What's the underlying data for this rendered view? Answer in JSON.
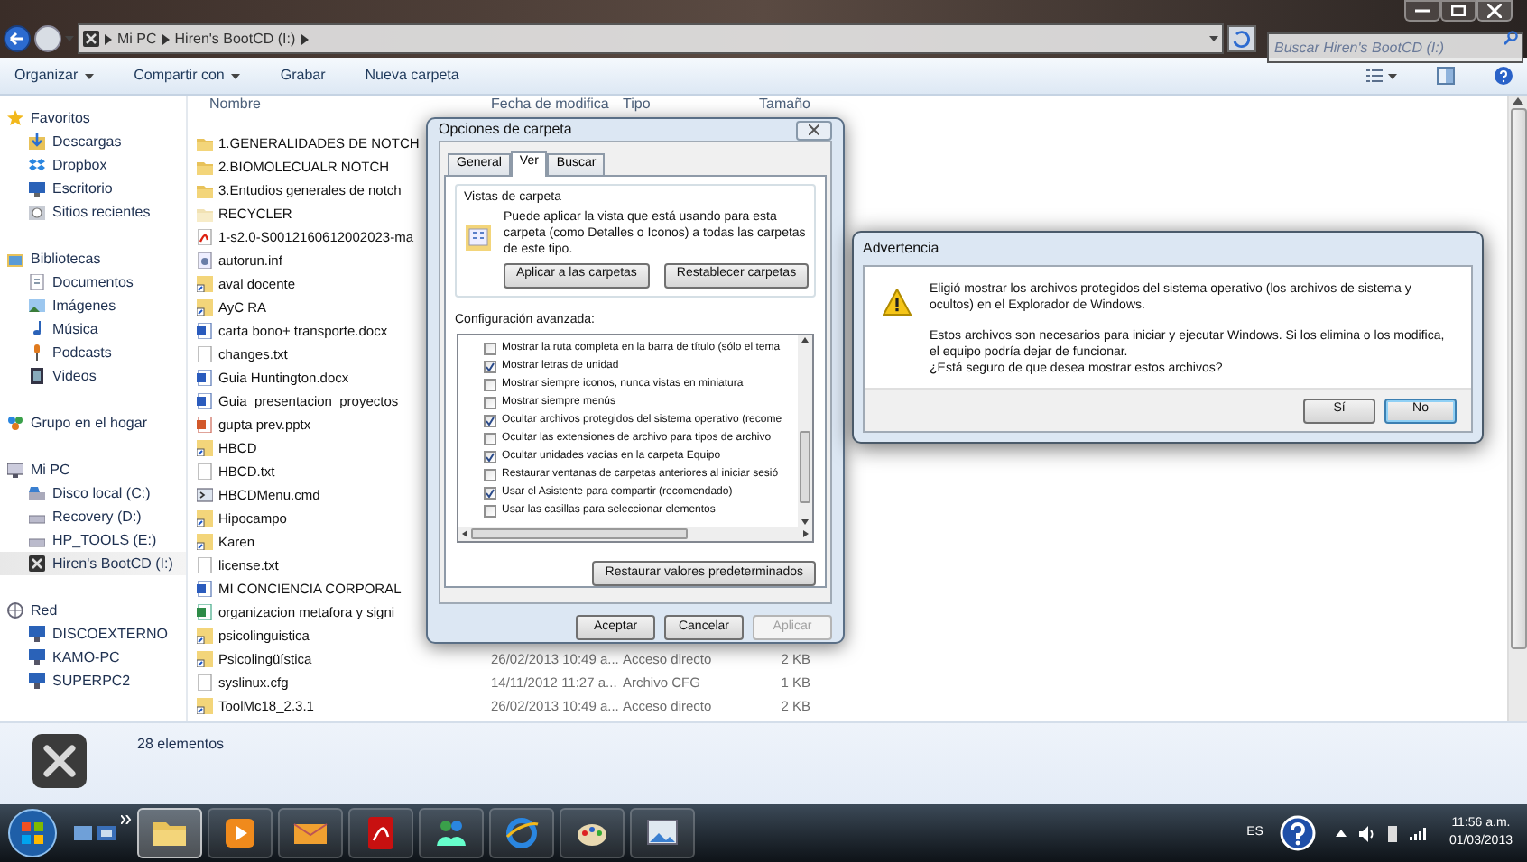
{
  "window": {
    "breadcrumbs": [
      "Mi PC",
      "Hiren's BootCD (I:)"
    ],
    "search": {
      "placeholder": "Buscar Hiren's BootCD (I:)"
    }
  },
  "toolbar": [
    {
      "label": "Organizar",
      "menu": true
    },
    {
      "label": "Compartir con",
      "menu": true
    },
    {
      "label": "Grabar",
      "menu": false
    },
    {
      "label": "Nueva carpeta",
      "menu": false
    }
  ],
  "sidebar": [
    {
      "label": "Favoritos",
      "kind": "star",
      "selected": false,
      "children": [
        {
          "label": "Descargas",
          "kind": "download",
          "selected": false
        },
        {
          "label": "Dropbox",
          "kind": "dropbox",
          "selected": false
        },
        {
          "label": "Escritorio",
          "kind": "desktop",
          "selected": false
        },
        {
          "label": "Sitios recientes",
          "kind": "recent",
          "selected": false
        }
      ]
    },
    {
      "label": "Bibliotecas",
      "kind": "library",
      "selected": false,
      "children": [
        {
          "label": "Documentos",
          "kind": "documents",
          "selected": false
        },
        {
          "label": "Imágenes",
          "kind": "images",
          "selected": false
        },
        {
          "label": "Música",
          "kind": "music",
          "selected": false
        },
        {
          "label": "Podcasts",
          "kind": "podcast",
          "selected": false
        },
        {
          "label": "Videos",
          "kind": "video",
          "selected": false
        }
      ]
    },
    {
      "label": "Grupo en el hogar",
      "kind": "homegroup",
      "selected": false
    },
    {
      "label": "Mi PC",
      "kind": "computer",
      "selected": false,
      "children": [
        {
          "label": "Disco local (C:)",
          "kind": "drive",
          "selected": false
        },
        {
          "label": "Recovery (D:)",
          "kind": "removable",
          "selected": false
        },
        {
          "label": "HP_TOOLS (E:)",
          "kind": "removable",
          "selected": false
        },
        {
          "label": "Hiren's BootCD (I:)",
          "kind": "tools",
          "selected": true
        }
      ]
    },
    {
      "label": "Red",
      "kind": "network",
      "selected": false,
      "children": [
        {
          "label": "DISCOEXTERNO",
          "kind": "pc",
          "selected": false
        },
        {
          "label": "KAMO-PC",
          "kind": "pc",
          "selected": false
        },
        {
          "label": "SUPERPC2",
          "kind": "pc",
          "selected": false
        }
      ]
    }
  ],
  "table": {
    "columns": [
      "Nombre",
      "Fecha de modifica",
      "Tipo",
      "Tamaño"
    ],
    "rows": [
      {
        "kind": "folder",
        "name": "1.GENERALIDADES DE NOTCH"
      },
      {
        "kind": "folder",
        "name": "2.BIOMOLECUALR NOTCH"
      },
      {
        "kind": "folder",
        "name": "3.Entudios generales de notch"
      },
      {
        "kind": "hidden_folder",
        "name": "RECYCLER"
      },
      {
        "kind": "pdf",
        "name": "1-s2.0-S0012160612002023-ma"
      },
      {
        "kind": "config",
        "name": "autorun.inf"
      },
      {
        "kind": "shortcut",
        "name": "aval docente"
      },
      {
        "kind": "shortcut",
        "name": "AyC RA"
      },
      {
        "kind": "word",
        "name": "carta bono+ transporte.docx"
      },
      {
        "kind": "text",
        "name": "changes.txt"
      },
      {
        "kind": "word",
        "name": "Guia Huntington.docx"
      },
      {
        "kind": "word",
        "name": "Guia_presentacion_proyectos"
      },
      {
        "kind": "ppt",
        "name": "gupta prev.pptx"
      },
      {
        "kind": "shortcut",
        "name": "HBCD"
      },
      {
        "kind": "text",
        "name": "HBCD.txt"
      },
      {
        "kind": "cmd",
        "name": "HBCDMenu.cmd"
      },
      {
        "kind": "shortcut",
        "name": "Hipocampo"
      },
      {
        "kind": "shortcut",
        "name": "Karen"
      },
      {
        "kind": "text",
        "name": "license.txt"
      },
      {
        "kind": "word",
        "name": "MI CONCIENCIA CORPORAL"
      },
      {
        "kind": "excel",
        "name": "organizacion metafora y signi"
      },
      {
        "kind": "shortcut",
        "name": "psicolinguistica"
      },
      {
        "kind": "shortcut",
        "name": "Psicolingüística",
        "date": "26/02/2013 10:49 a...",
        "type": "Acceso directo",
        "size": "2 KB"
      },
      {
        "kind": "text",
        "name": "syslinux.cfg",
        "date": "14/11/2012 11:27 a...",
        "type": "Archivo CFG",
        "size": "1 KB"
      },
      {
        "kind": "shortcut",
        "name": "ToolMc18_2.3.1",
        "date": "26/02/2013 10:49 a...",
        "type": "Acceso directo",
        "size": "2 KB"
      }
    ]
  },
  "details": {
    "count": "28 elementos"
  },
  "folder_options": {
    "title": "Opciones de carpeta",
    "tabs": [
      {
        "label": "General",
        "selected": false
      },
      {
        "label": "Ver",
        "selected": true
      },
      {
        "label": "Buscar",
        "selected": false
      }
    ],
    "views_group": {
      "title": "Vistas de carpeta",
      "text": "Puede aplicar la vista que está usando para esta carpeta (como Detalles o Iconos) a todas las carpetas de este tipo.",
      "buttons": [
        "Aplicar a las carpetas",
        "Restablecer carpetas"
      ]
    },
    "advanced_label": "Configuración avanzada:",
    "settings": [
      {
        "label": "Mostrar la ruta completa en la barra de título (sólo el tema",
        "checked": false
      },
      {
        "label": "Mostrar letras de unidad",
        "checked": true
      },
      {
        "label": "Mostrar siempre iconos, nunca vistas en miniatura",
        "checked": false
      },
      {
        "label": "Mostrar siempre menús",
        "checked": false
      },
      {
        "label": "Ocultar archivos protegidos del sistema operativo (recome",
        "checked": true
      },
      {
        "label": "Ocultar las extensiones de archivo para tipos de archivo",
        "checked": false
      },
      {
        "label": "Ocultar unidades vacías en la carpeta Equipo",
        "checked": true
      },
      {
        "label": "Restaurar ventanas de carpetas anteriores al iniciar sesió",
        "checked": false
      },
      {
        "label": "Usar el Asistente para compartir (recomendado)",
        "checked": true
      },
      {
        "label": "Usar las casillas para seleccionar elementos",
        "checked": false
      }
    ],
    "restore_button": "Restaurar valores predeterminados",
    "buttons": [
      {
        "label": "Aceptar",
        "disabled": false
      },
      {
        "label": "Cancelar",
        "disabled": false
      },
      {
        "label": "Aplicar",
        "disabled": true
      }
    ]
  },
  "warning": {
    "title": "Advertencia",
    "message": [
      "Eligió mostrar los archivos protegidos del sistema operativo (los archivos de sistema y ocultos) en el Explorador de Windows.",
      "Estos archivos son necesarios para iniciar y ejecutar Windows. Si los elimina o los modifica, el equipo podría dejar de funcionar.",
      "¿Está seguro de que desea mostrar estos archivos?"
    ],
    "buttons": [
      {
        "label": "Sí",
        "selected": false
      },
      {
        "label": "No",
        "selected": true
      }
    ]
  },
  "taskbar": {
    "apps": [
      {
        "kind": "explorer",
        "selected": true
      },
      {
        "kind": "media",
        "selected": false
      },
      {
        "kind": "mail",
        "selected": false
      },
      {
        "kind": "pdf",
        "selected": false
      },
      {
        "kind": "messenger",
        "selected": false
      },
      {
        "kind": "browser",
        "selected": false
      },
      {
        "kind": "paint",
        "selected": false
      },
      {
        "kind": "photos",
        "selected": false
      }
    ],
    "language": "ES",
    "time": "11:56 a.m.",
    "date": "01/03/2013"
  }
}
